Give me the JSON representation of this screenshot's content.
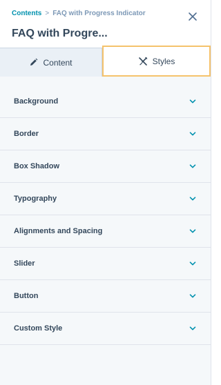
{
  "header": {
    "breadcrumb_root": "Contents",
    "breadcrumb_separator": ">",
    "breadcrumb_current": "FAQ with Progress Indicator",
    "title": "FAQ with Progre...",
    "close_icon": "close-icon"
  },
  "tabs": [
    {
      "label": "Content",
      "icon": "pencil-icon",
      "active": false
    },
    {
      "label": "Styles",
      "icon": "styles-icon",
      "active": true
    }
  ],
  "sections": [
    {
      "label": "Background"
    },
    {
      "label": "Border"
    },
    {
      "label": "Box Shadow"
    },
    {
      "label": "Typography"
    },
    {
      "label": "Alignments and Spacing"
    },
    {
      "label": "Slider"
    },
    {
      "label": "Button"
    },
    {
      "label": "Custom Style"
    }
  ],
  "colors": {
    "accent": "#0091ae",
    "active_tab_border": "#f5c26b",
    "text": "#33475b",
    "muted": "#7c98b6"
  }
}
